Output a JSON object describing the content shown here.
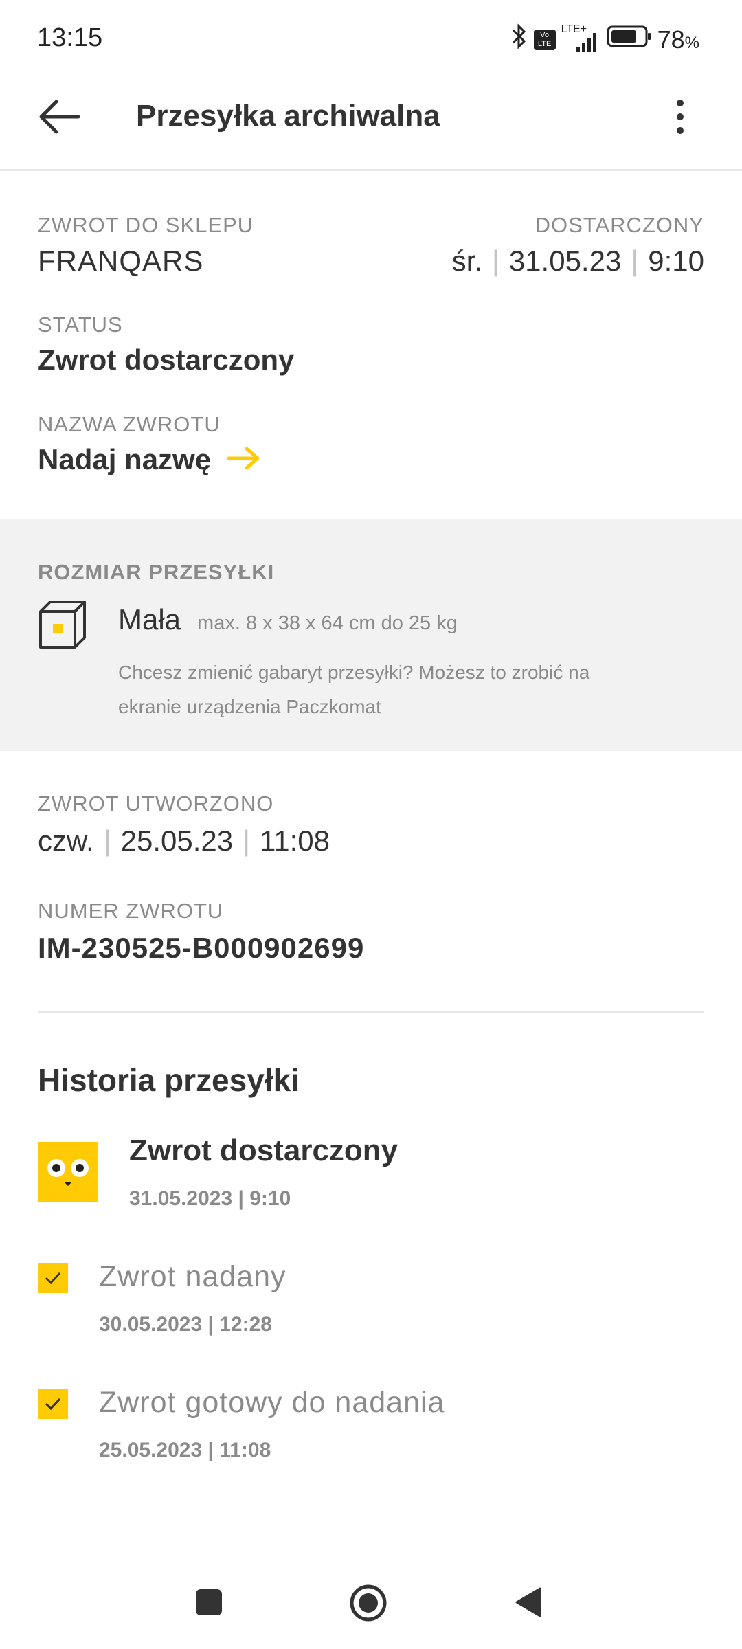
{
  "status_bar": {
    "time": "13:15",
    "network": "LTE+",
    "volte": "Vo LTE",
    "battery_percent": "78",
    "battery_percent_sign": "%",
    "battery_level": 0.78
  },
  "app_bar": {
    "title": "Przesyłka archiwalna"
  },
  "shipment": {
    "shop_label": "ZWROT DO SKLEPU",
    "shop_value": "FRANQARS",
    "delivered_label": "DOSTARCZONY",
    "delivered_day": "śr.",
    "delivered_date": "31.05.23",
    "delivered_time": "9:10",
    "status_label": "STATUS",
    "status_value": "Zwrot dostarczony",
    "name_label": "NAZWA ZWROTU",
    "name_action": "Nadaj nazwę"
  },
  "size": {
    "label": "ROZMIAR PRZESYŁKI",
    "name": "Mała",
    "dims": "max. 8 x 38 x 64 cm do 25 kg",
    "note_line1": "Chcesz zmienić gabaryt przesyłki? Możesz to zrobić na",
    "note_line2": "ekranie urządzenia Paczkomat"
  },
  "created": {
    "label": "ZWROT UTWORZONO",
    "day": "czw.",
    "date": "25.05.23",
    "time": "11:08"
  },
  "return_number": {
    "label": "NUMER ZWROTU",
    "value": "IM-230525-B000902699"
  },
  "history": {
    "title": "Historia przesyłki",
    "items": [
      {
        "label": "Zwrot dostarczony",
        "date": "31.05.2023 | 9:10"
      },
      {
        "label": "Zwrot nadany",
        "date": "30.05.2023 | 12:28"
      },
      {
        "label": "Zwrot gotowy do nadania",
        "date": "25.05.2023 | 11:08"
      }
    ]
  },
  "colors": {
    "accent": "#ffcb05",
    "text": "#333333",
    "muted": "#8a8a8a",
    "panel": "#f2f2f2"
  }
}
